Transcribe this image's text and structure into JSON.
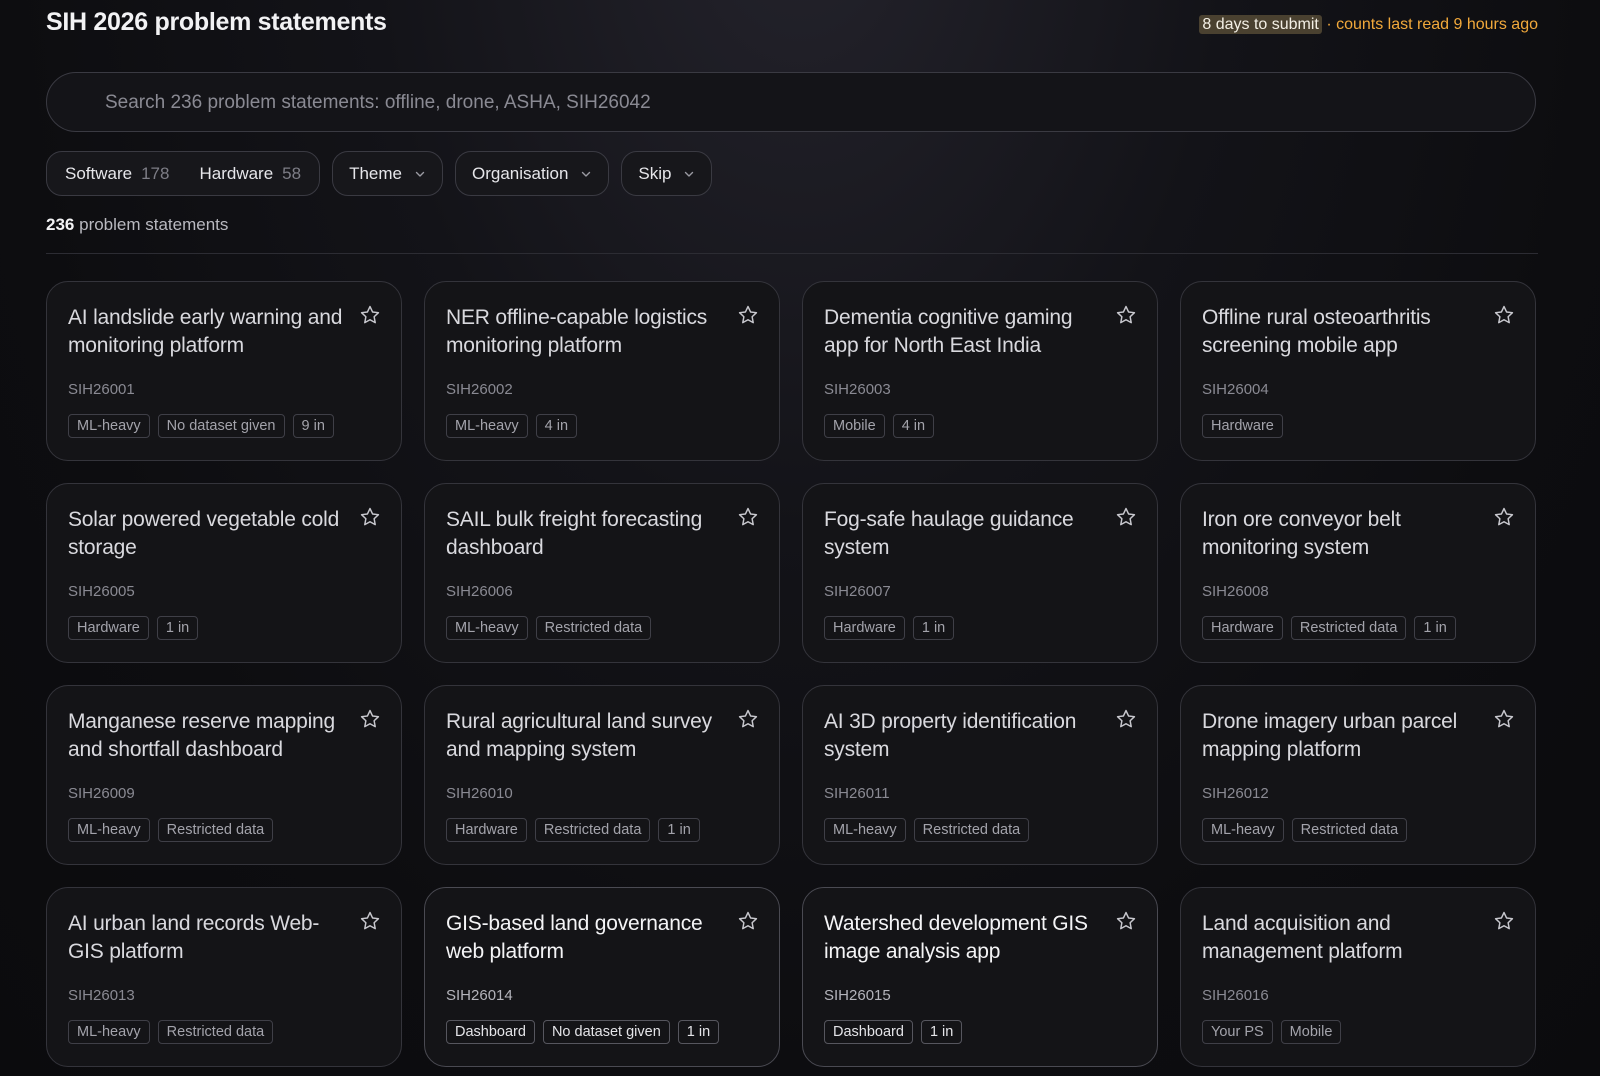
{
  "header": {
    "title": "SIH 2026 problem statements",
    "deadline": "8 days to submit",
    "note": "· counts last read 9 hours ago"
  },
  "search": {
    "placeholder": "Search 236 problem statements: offline, drone, ASHA, SIH26042"
  },
  "filters": {
    "category": [
      {
        "label": "Software",
        "count": "178"
      },
      {
        "label": "Hardware",
        "count": "58"
      }
    ],
    "theme": "Theme",
    "organisation": "Organisation",
    "skip": "Skip"
  },
  "results": {
    "count": "236",
    "label": "problem statements"
  },
  "icons": {
    "star": "star-icon",
    "chevron": "chevron-down-icon"
  },
  "cards": [
    {
      "title": "AI landslide early warning and monitoring platform",
      "id": "SIH26001",
      "tags": [
        "ML-heavy",
        "No dataset given",
        "9 in"
      ]
    },
    {
      "title": "NER offline-capable logistics monitoring platform",
      "id": "SIH26002",
      "tags": [
        "ML-heavy",
        "4 in"
      ]
    },
    {
      "title": "Dementia cognitive gaming app for North East India",
      "id": "SIH26003",
      "tags": [
        "Mobile",
        "4 in"
      ]
    },
    {
      "title": "Offline rural osteoarthritis screening mobile app",
      "id": "SIH26004",
      "tags": [
        "Hardware"
      ]
    },
    {
      "title": "Solar powered vegetable cold storage",
      "id": "SIH26005",
      "tags": [
        "Hardware",
        "1 in"
      ]
    },
    {
      "title": "SAIL bulk freight forecasting dashboard",
      "id": "SIH26006",
      "tags": [
        "ML-heavy",
        "Restricted data"
      ]
    },
    {
      "title": "Fog-safe haulage guidance system",
      "id": "SIH26007",
      "tags": [
        "Hardware",
        "1 in"
      ]
    },
    {
      "title": "Iron ore conveyor belt monitoring system",
      "id": "SIH26008",
      "tags": [
        "Hardware",
        "Restricted data",
        "1 in"
      ]
    },
    {
      "title": "Manganese reserve mapping and shortfall dashboard",
      "id": "SIH26009",
      "tags": [
        "ML-heavy",
        "Restricted data"
      ]
    },
    {
      "title": "Rural agricultural land survey and mapping system",
      "id": "SIH26010",
      "tags": [
        "Hardware",
        "Restricted data",
        "1 in"
      ]
    },
    {
      "title": "AI 3D property identification system",
      "id": "SIH26011",
      "tags": [
        "ML-heavy",
        "Restricted data"
      ]
    },
    {
      "title": "Drone imagery urban parcel mapping platform",
      "id": "SIH26012",
      "tags": [
        "ML-heavy",
        "Restricted data"
      ]
    },
    {
      "title": "AI urban land records Web-GIS platform",
      "id": "SIH26013",
      "tags": [
        "ML-heavy",
        "Restricted data"
      ]
    },
    {
      "title": "GIS-based land governance web platform",
      "id": "SIH26014",
      "tags": [
        "Dashboard",
        "No dataset given",
        "1 in"
      ],
      "active": true
    },
    {
      "title": "Watershed development GIS image analysis app",
      "id": "SIH26015",
      "tags": [
        "Dashboard",
        "1 in"
      ],
      "active": true
    },
    {
      "title": "Land acquisition and management platform",
      "id": "SIH26016",
      "tags": [
        "Your PS",
        "Mobile"
      ]
    }
  ]
}
